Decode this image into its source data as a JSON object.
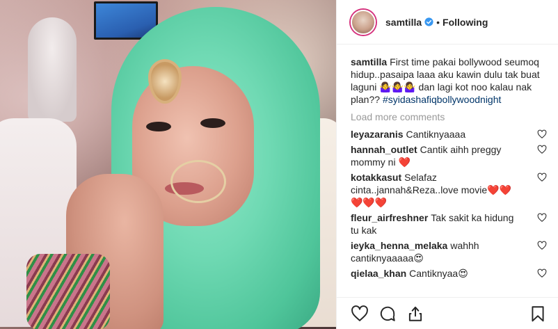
{
  "post": {
    "username": "samtilla",
    "separator": "•",
    "follow_status": "Following"
  },
  "caption": {
    "username": "samtilla",
    "text": "First time pakai bollywood seumoq hidup..pasaipa laaa aku kawin dulu tak buat laguni",
    "emoji": "🤷‍♀️🤷‍♀️🤷‍♀️",
    "text2": "dan lagi kot noo kalau nak plan??",
    "hashtag": "#syidashafiqbollywoodnight"
  },
  "load_more": "Load more comments",
  "comments": [
    {
      "username": "leyazaranis",
      "text": "Cantiknyaaaa"
    },
    {
      "username": "hannah_outlet",
      "text": "Cantik aihh preggy mommy ni ❤️"
    },
    {
      "username": "kotakkasut",
      "text": "Selafaz cinta..jannah&Reza..love movie❤️❤️❤️❤️❤️"
    },
    {
      "username": "fleur_airfreshner",
      "text": "Tak sakit ka hidung tu kak"
    },
    {
      "username": "ieyka_henna_melaka",
      "text": "wahhh cantiknyaaaaa😍"
    },
    {
      "username": "qielaa_khan",
      "text": "Cantiknyaa😍"
    }
  ],
  "icons": {
    "avatar": "avatar",
    "verified": "verified-badge-icon",
    "like": "heart-icon",
    "comment": "comment-icon",
    "share": "share-icon",
    "save": "bookmark-icon"
  },
  "colors": {
    "text": "#262626",
    "muted": "#999999",
    "link": "#003569",
    "verified": "#3897f0",
    "story_ring": "#d5337e"
  }
}
